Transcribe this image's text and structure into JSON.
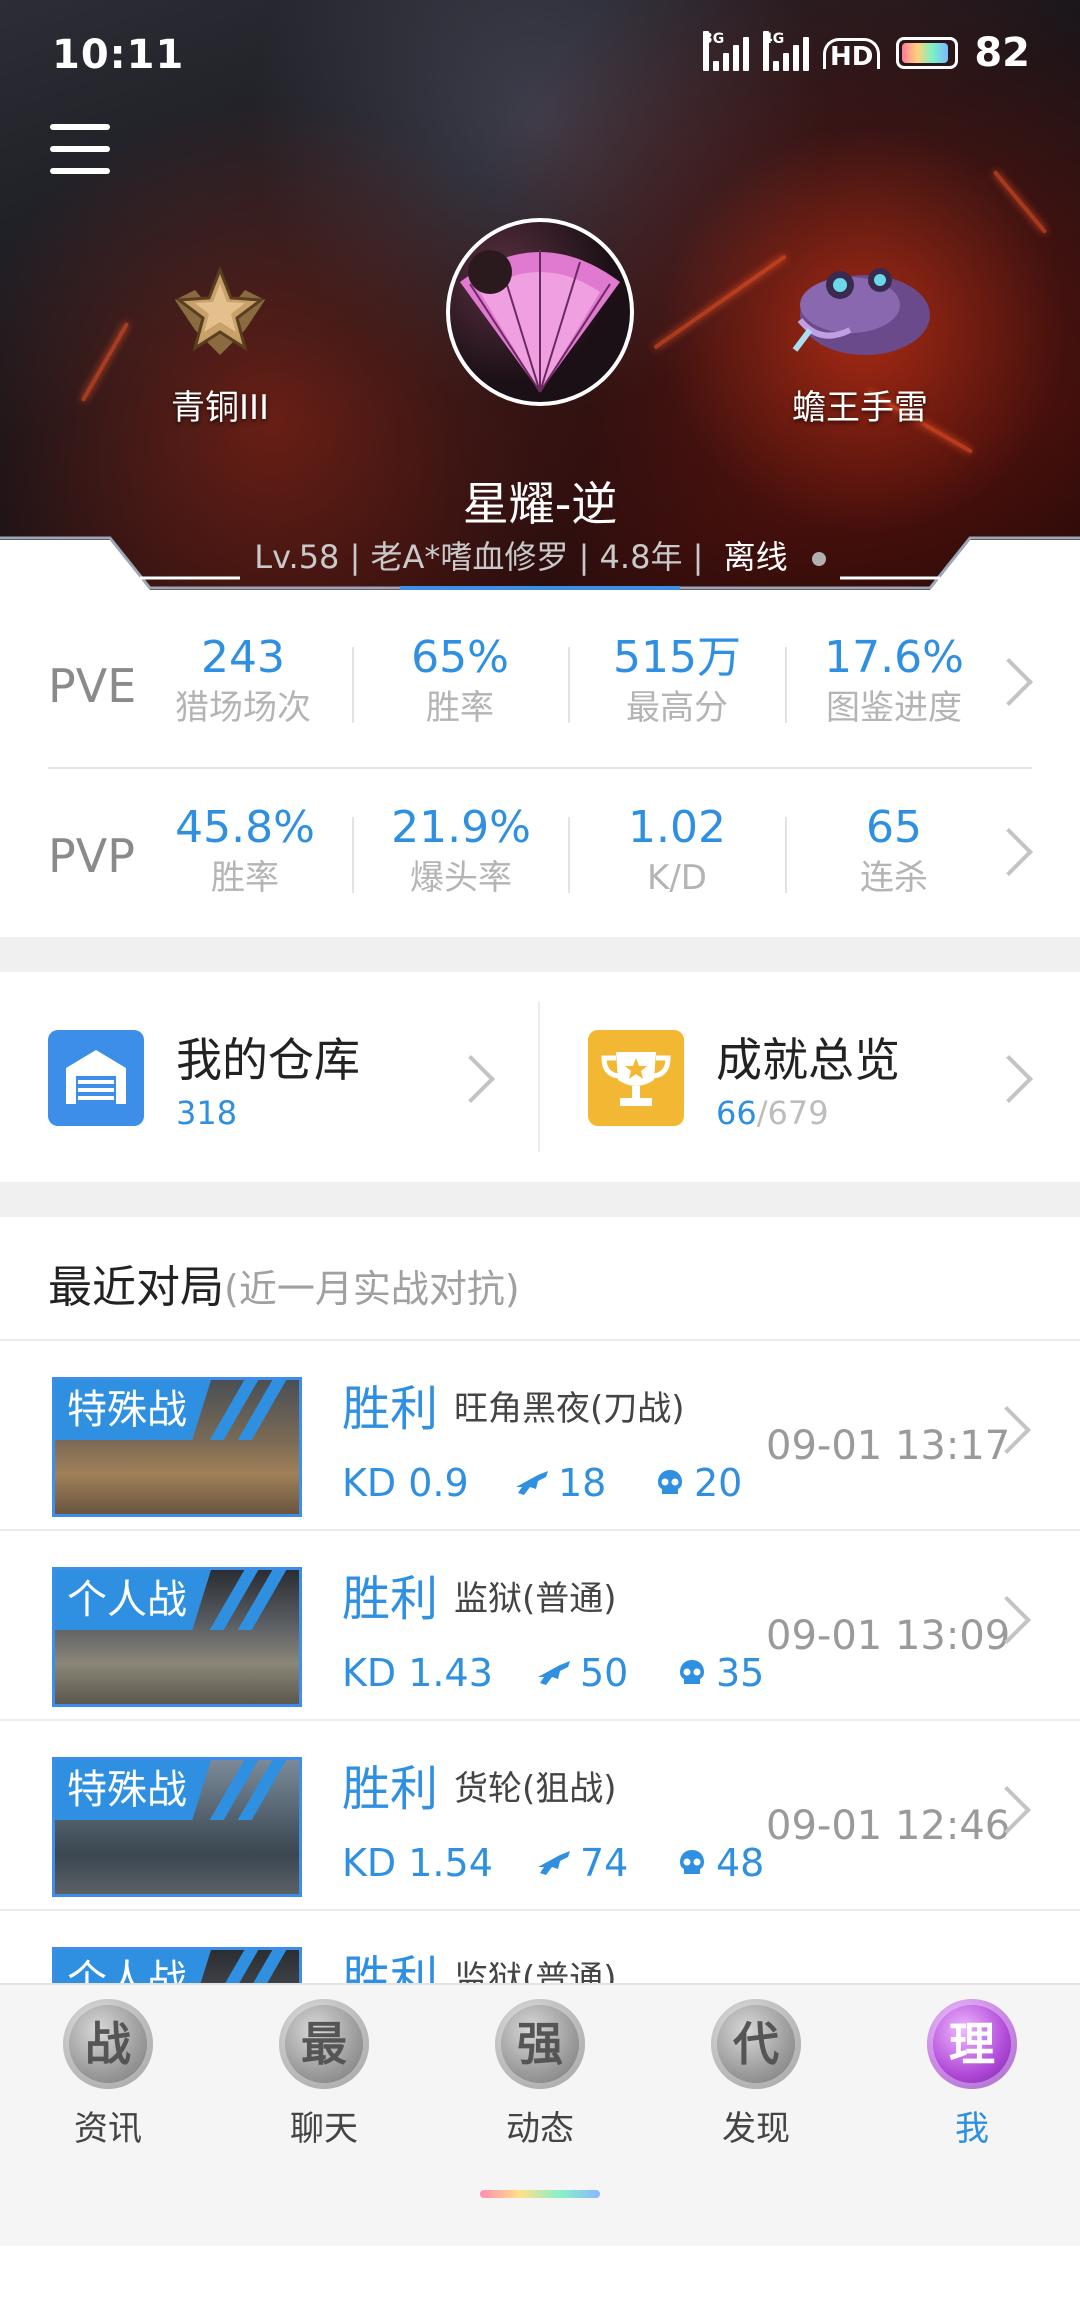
{
  "status_bar": {
    "time": "10:11",
    "network_1": "3G",
    "network_2": "4G",
    "hd": "HD",
    "battery": "82"
  },
  "profile": {
    "rank_label": "青铜III",
    "weapon_label": "蟾王手雷",
    "nickname": "星耀-逆",
    "info": "Lv.58 | 老A*嗜血修罗 | 4.8年 |",
    "status": "离线"
  },
  "pve": {
    "label": "PVE",
    "stats": [
      {
        "value": "243",
        "caption": "猎场场次"
      },
      {
        "value": "65%",
        "caption": "胜率"
      },
      {
        "value": "515万",
        "caption": "最高分"
      },
      {
        "value": "17.6%",
        "caption": "图鉴进度"
      }
    ]
  },
  "pvp": {
    "label": "PVP",
    "stats": [
      {
        "value": "45.8%",
        "caption": "胜率"
      },
      {
        "value": "21.9%",
        "caption": "爆头率"
      },
      {
        "value": "1.02",
        "caption": "K/D"
      },
      {
        "value": "65",
        "caption": "连杀"
      }
    ]
  },
  "quick_links": {
    "warehouse": {
      "title": "我的仓库",
      "count": "318"
    },
    "achievements": {
      "title": "成就总览",
      "count": "66",
      "total": "/679"
    }
  },
  "recent": {
    "title": "最近对局",
    "note": "(近一月实战对抗)",
    "matches": [
      {
        "mode": "特殊战",
        "result": "胜利",
        "map": "旺角黑夜(刀战)",
        "time": "09-01 13:17",
        "kd": "KD 0.9",
        "kills": "18",
        "deaths": "20"
      },
      {
        "mode": "个人战",
        "result": "胜利",
        "map": "监狱(普通)",
        "time": "09-01 13:09",
        "kd": "KD 1.43",
        "kills": "50",
        "deaths": "35"
      },
      {
        "mode": "特殊战",
        "result": "胜利",
        "map": "货轮(狙战)",
        "time": "09-01 12:46",
        "kd": "KD 1.54",
        "kills": "74",
        "deaths": "48"
      },
      {
        "mode": "个人战",
        "result": "胜利",
        "map": "监狱(普通)"
      }
    ]
  },
  "bottom_nav": [
    {
      "glyph": "战",
      "label": "资讯"
    },
    {
      "glyph": "最",
      "label": "聊天"
    },
    {
      "glyph": "强",
      "label": "动态"
    },
    {
      "glyph": "代",
      "label": "发现"
    },
    {
      "glyph": "理",
      "label": "我"
    }
  ],
  "colors": {
    "accent": "#2f8fe0",
    "warehouse_icon": "#3d8ee8",
    "achievement_icon": "#f2b733",
    "active_nav": "#b04ad8"
  }
}
